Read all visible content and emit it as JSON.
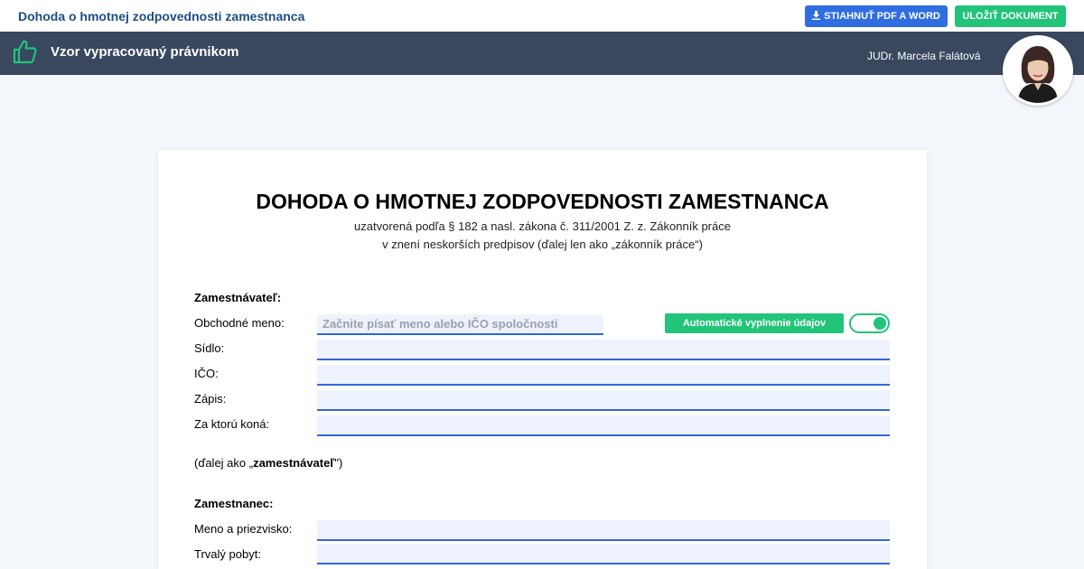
{
  "topbar": {
    "title": "Dohoda o hmotnej zodpovednosti zamestnanca",
    "download_label": "STIAHNUŤ PDF A WORD",
    "save_label": "ULOŽIŤ DOKUMENT"
  },
  "banner": {
    "text": "Vzor vypracovaný právnikom",
    "author": "JUDr. Marcela Falátová",
    "icon": "thumbs-up-icon"
  },
  "document": {
    "title": "DOHODA O HMOTNEJ ZODPOVEDNOSTI ZAMESTNANCA",
    "subtitle_line1": "uzatvorená podľa § 182 a nasl. zákona č. 311/2001 Z. z. Zákonník práce",
    "subtitle_line2": "v znení neskorších predpisov (ďalej len ako „zákonník práce“)",
    "employer": {
      "heading": "Zamestnávateľ:",
      "name_label": "Obchodné meno:",
      "name_placeholder": "Začnite písať meno alebo IČO spoločnosti",
      "seat_label": "Sídlo:",
      "ico_label": "IČO:",
      "registration_label": "Zápis:",
      "acting_label": "Za ktorú koná:",
      "auto_fill_label": "Automatické vyplnenie údajov",
      "auto_fill_enabled": true,
      "alias_prefix": "(ďalej ako „",
      "alias_bold": "zamestnávateľ",
      "alias_suffix": "\")"
    },
    "employee": {
      "heading": "Zamestnanec:",
      "name_label": "Meno a priezvisko:",
      "residence_label": "Trvalý pobyt:"
    }
  },
  "colors": {
    "accent_blue": "#2f6de1",
    "accent_green": "#21c479",
    "banner_bg": "#39475f",
    "title_blue": "#1d4f82"
  }
}
